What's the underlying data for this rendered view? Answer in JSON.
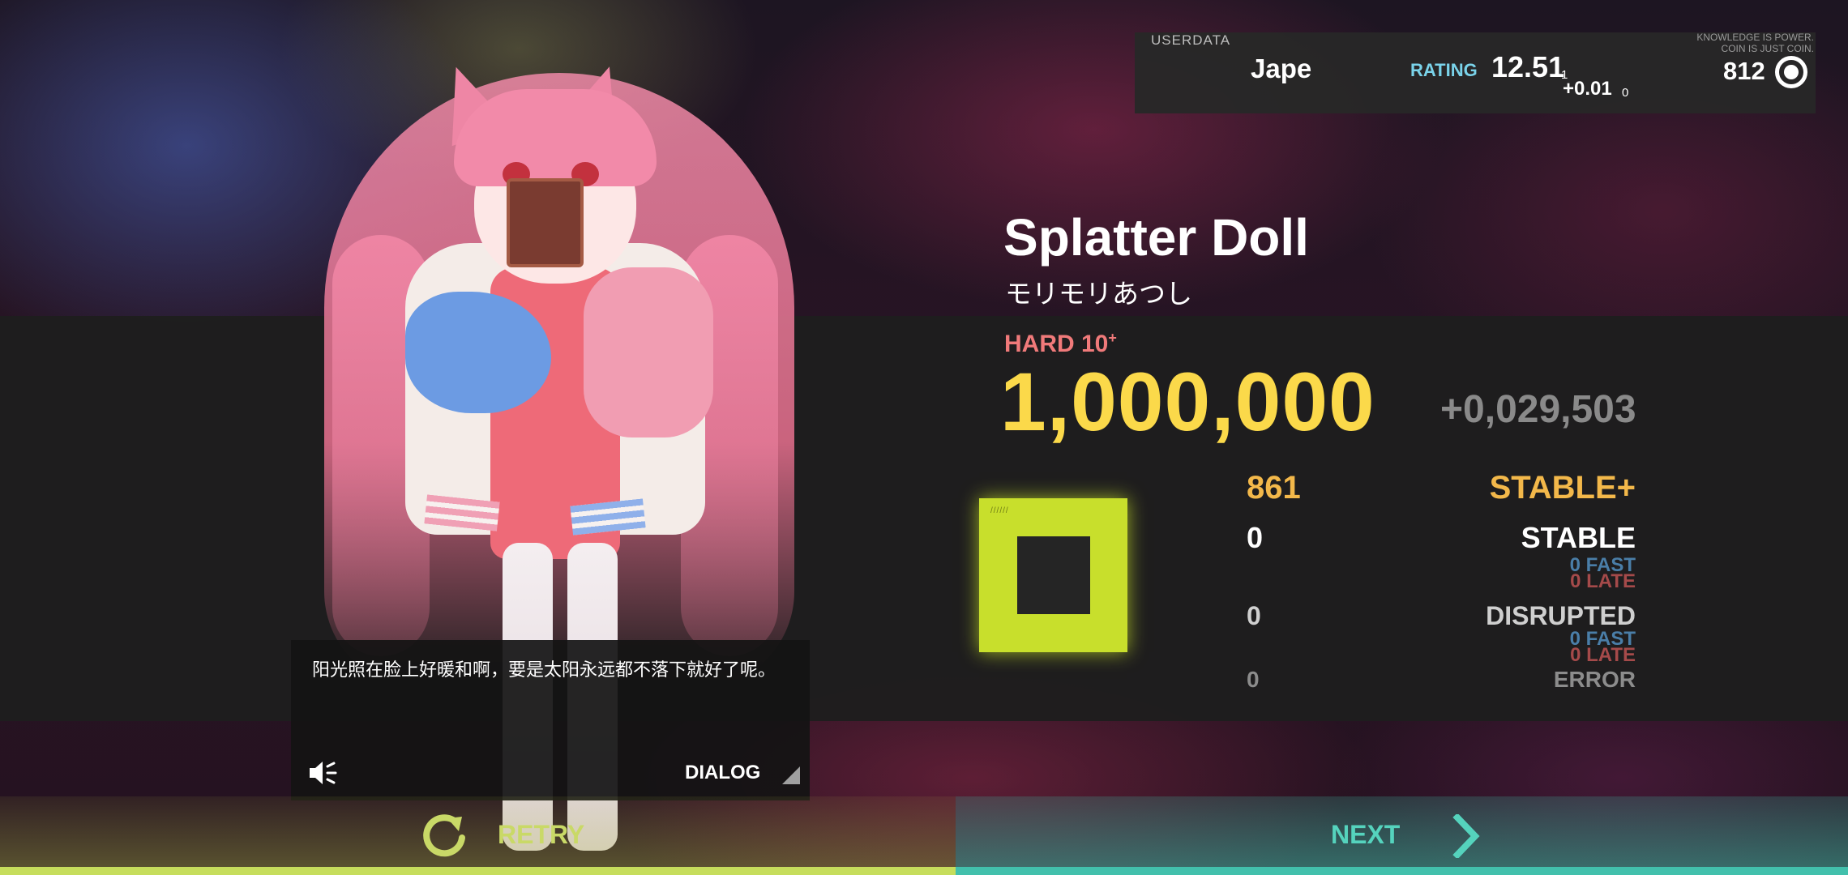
{
  "user": {
    "label": "USERDATA",
    "name": "Jape",
    "rating_label": "RATING",
    "rating_value": "12.51",
    "rating_suffix": "1",
    "rating_delta": "+0.01",
    "rating_delta_suffix": "0",
    "knowledge_line1": "KNOWLEDGE IS POWER.",
    "knowledge_line2": "COIN IS JUST COIN.",
    "coins": "812",
    "coin_icon": "coin-icon"
  },
  "song": {
    "title": "Splatter Doll",
    "artist": "モリモリあつし",
    "difficulty": "HARD 10",
    "difficulty_plus": "+",
    "score": "1,000,000",
    "score_delta": "+0,029,503"
  },
  "grade": {
    "tag": "//////",
    "color": "#c8df2c"
  },
  "judgements": {
    "stable_plus": {
      "count": "861",
      "label": "STABLE+"
    },
    "stable": {
      "count": "0",
      "label": "STABLE",
      "fast": "0 FAST",
      "late": "0 LATE"
    },
    "disrupted": {
      "count": "0",
      "label": "DISRUPTED",
      "fast": "0 FAST",
      "late": "0 LATE"
    },
    "error": {
      "count": "0",
      "label": "ERROR"
    }
  },
  "dialog": {
    "text": "阳光照在脸上好暖和啊，要是太阳永远都不落下就好了呢。",
    "button": "DIALOG",
    "speaker_icon": "speaker-muted-icon"
  },
  "actions": {
    "retry": "RETRY",
    "next": "NEXT",
    "retry_icon": "retry-icon",
    "next_icon": "chevron-right-icon"
  },
  "colors": {
    "score": "#fbd94a",
    "difficulty": "#f07a7a",
    "stable_plus": "#f3b84a",
    "retry": "#c9d967",
    "next": "#55d3bd",
    "rating": "#7ad3ea"
  }
}
